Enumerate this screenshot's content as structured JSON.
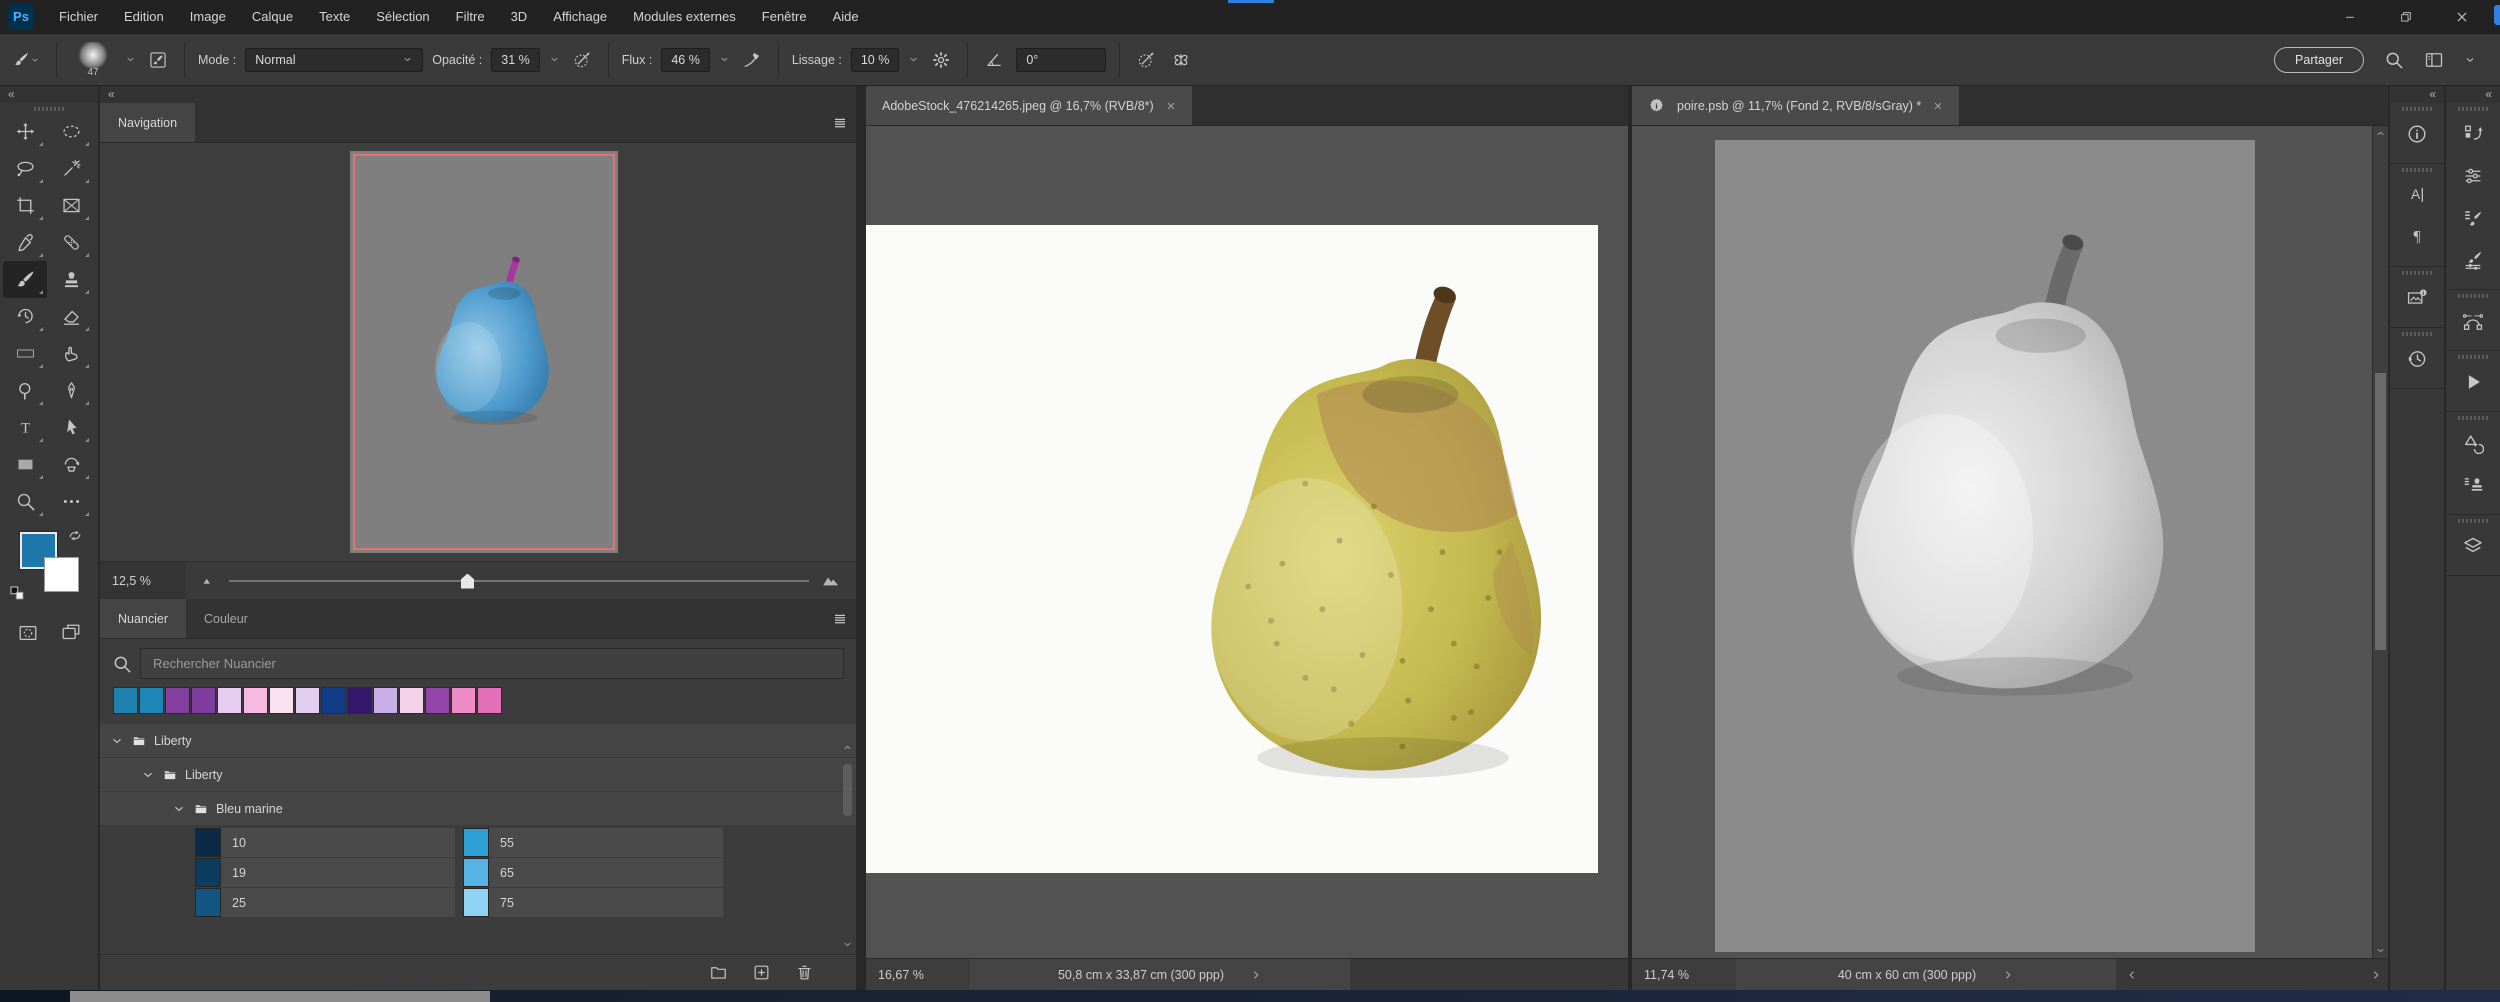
{
  "titlebar": {
    "app_icon_label": "Ps",
    "menus": [
      "Fichier",
      "Edition",
      "Image",
      "Calque",
      "Texte",
      "Sélection",
      "Filtre",
      "3D",
      "Affichage",
      "Modules externes",
      "Fenêtre",
      "Aide"
    ]
  },
  "options_bar": {
    "brush_size": "47",
    "mode_label": "Mode :",
    "mode_value": "Normal",
    "opacity_label": "Opacité :",
    "opacity_value": "31 %",
    "flow_label": "Flux :",
    "flow_value": "46 %",
    "smoothing_label": "Lissage :",
    "smoothing_value": "10 %",
    "angle_value": "0°",
    "share_button": "Partager"
  },
  "toolbar": {
    "collapse_glyph": "«",
    "foreground_color": "#1d77a8",
    "background_color": "#ffffff",
    "tools": [
      {
        "name": "move",
        "icon": "move"
      },
      {
        "name": "marquee",
        "icon": "marquee"
      },
      {
        "name": "lasso",
        "icon": "lasso"
      },
      {
        "name": "magic-wand",
        "icon": "wand"
      },
      {
        "name": "crop",
        "icon": "crop"
      },
      {
        "name": "frame",
        "icon": "frame"
      },
      {
        "name": "eyedropper",
        "icon": "eyedropper"
      },
      {
        "name": "healing-brush",
        "icon": "healing"
      },
      {
        "name": "brush",
        "icon": "brush",
        "selected": true
      },
      {
        "name": "clone-stamp",
        "icon": "stamp"
      },
      {
        "name": "history-brush",
        "icon": "historybrush"
      },
      {
        "name": "eraser",
        "icon": "eraser"
      },
      {
        "name": "gradient",
        "icon": "gradient"
      },
      {
        "name": "smudge",
        "icon": "smudge"
      },
      {
        "name": "dodge",
        "icon": "dodge"
      },
      {
        "name": "pen",
        "icon": "pen"
      },
      {
        "name": "type",
        "icon": "typeT"
      },
      {
        "name": "path-selection",
        "icon": "pathselect"
      },
      {
        "name": "rectangle",
        "icon": "rectangle"
      },
      {
        "name": "rotate-view",
        "icon": "rotateview"
      },
      {
        "name": "zoom",
        "icon": "zoomtool"
      },
      {
        "name": "edit-toolbar",
        "icon": "ellipsis"
      }
    ]
  },
  "navigator": {
    "tab_label": "Navigation",
    "zoom_value": "12,5 %"
  },
  "swatches": {
    "tab_swatches": "Nuancier",
    "tab_color": "Couleur",
    "search_placeholder": "Rechercher Nuancier",
    "recent": [
      "#1e81ae",
      "#1f86b8",
      "#833f9e",
      "#7f3da0",
      "#e7cdf2",
      "#f6b9e2",
      "#f9e1f0",
      "#e3cdf0",
      "#123c85",
      "#33186b",
      "#c9aee8",
      "#f6d2ea",
      "#9346a8",
      "#ef8cc8",
      "#e470ba"
    ],
    "tree": [
      {
        "label": "Liberty",
        "depth": 0
      },
      {
        "label": "Liberty",
        "depth": 1
      },
      {
        "label": "Bleu marine",
        "depth": 2
      }
    ],
    "rows": [
      {
        "cells": [
          {
            "value": "10",
            "color": "#0b2a47"
          },
          {
            "value": "55",
            "color": "#2d9fd6"
          }
        ]
      },
      {
        "cells": [
          {
            "value": "19",
            "color": "#0d3c61"
          },
          {
            "value": "65",
            "color": "#55b4e4"
          }
        ]
      },
      {
        "cells": [
          {
            "value": "25",
            "color": "#135682"
          },
          {
            "value": "75",
            "color": "#8ed2f4"
          }
        ]
      }
    ]
  },
  "documents": [
    {
      "tab_title": "AdobeStock_476214265.jpeg @ 16,7% (RVB/8*)",
      "status_zoom": "16,67 %",
      "status_dims": "50,8 cm x 33,87 cm (300 ppp)"
    },
    {
      "tab_title": "poire.psb @ 11,7% (Fond 2, RVB/8/sGray) *",
      "status_zoom": "11,74 %",
      "status_dims": "40 cm x 60 cm (300 ppp)"
    }
  ],
  "right_rail": {
    "inner_groups": [
      [
        "info"
      ],
      [
        "character",
        "paragraph"
      ],
      [
        "libraries"
      ],
      [
        "history"
      ]
    ],
    "outer_groups": [
      [
        "layer-comps",
        "adjustments",
        "brushes",
        "brush-settings"
      ],
      [
        "paths"
      ],
      [
        "actions"
      ],
      [
        "shapes",
        "clone-source"
      ],
      [
        "layers"
      ]
    ]
  }
}
